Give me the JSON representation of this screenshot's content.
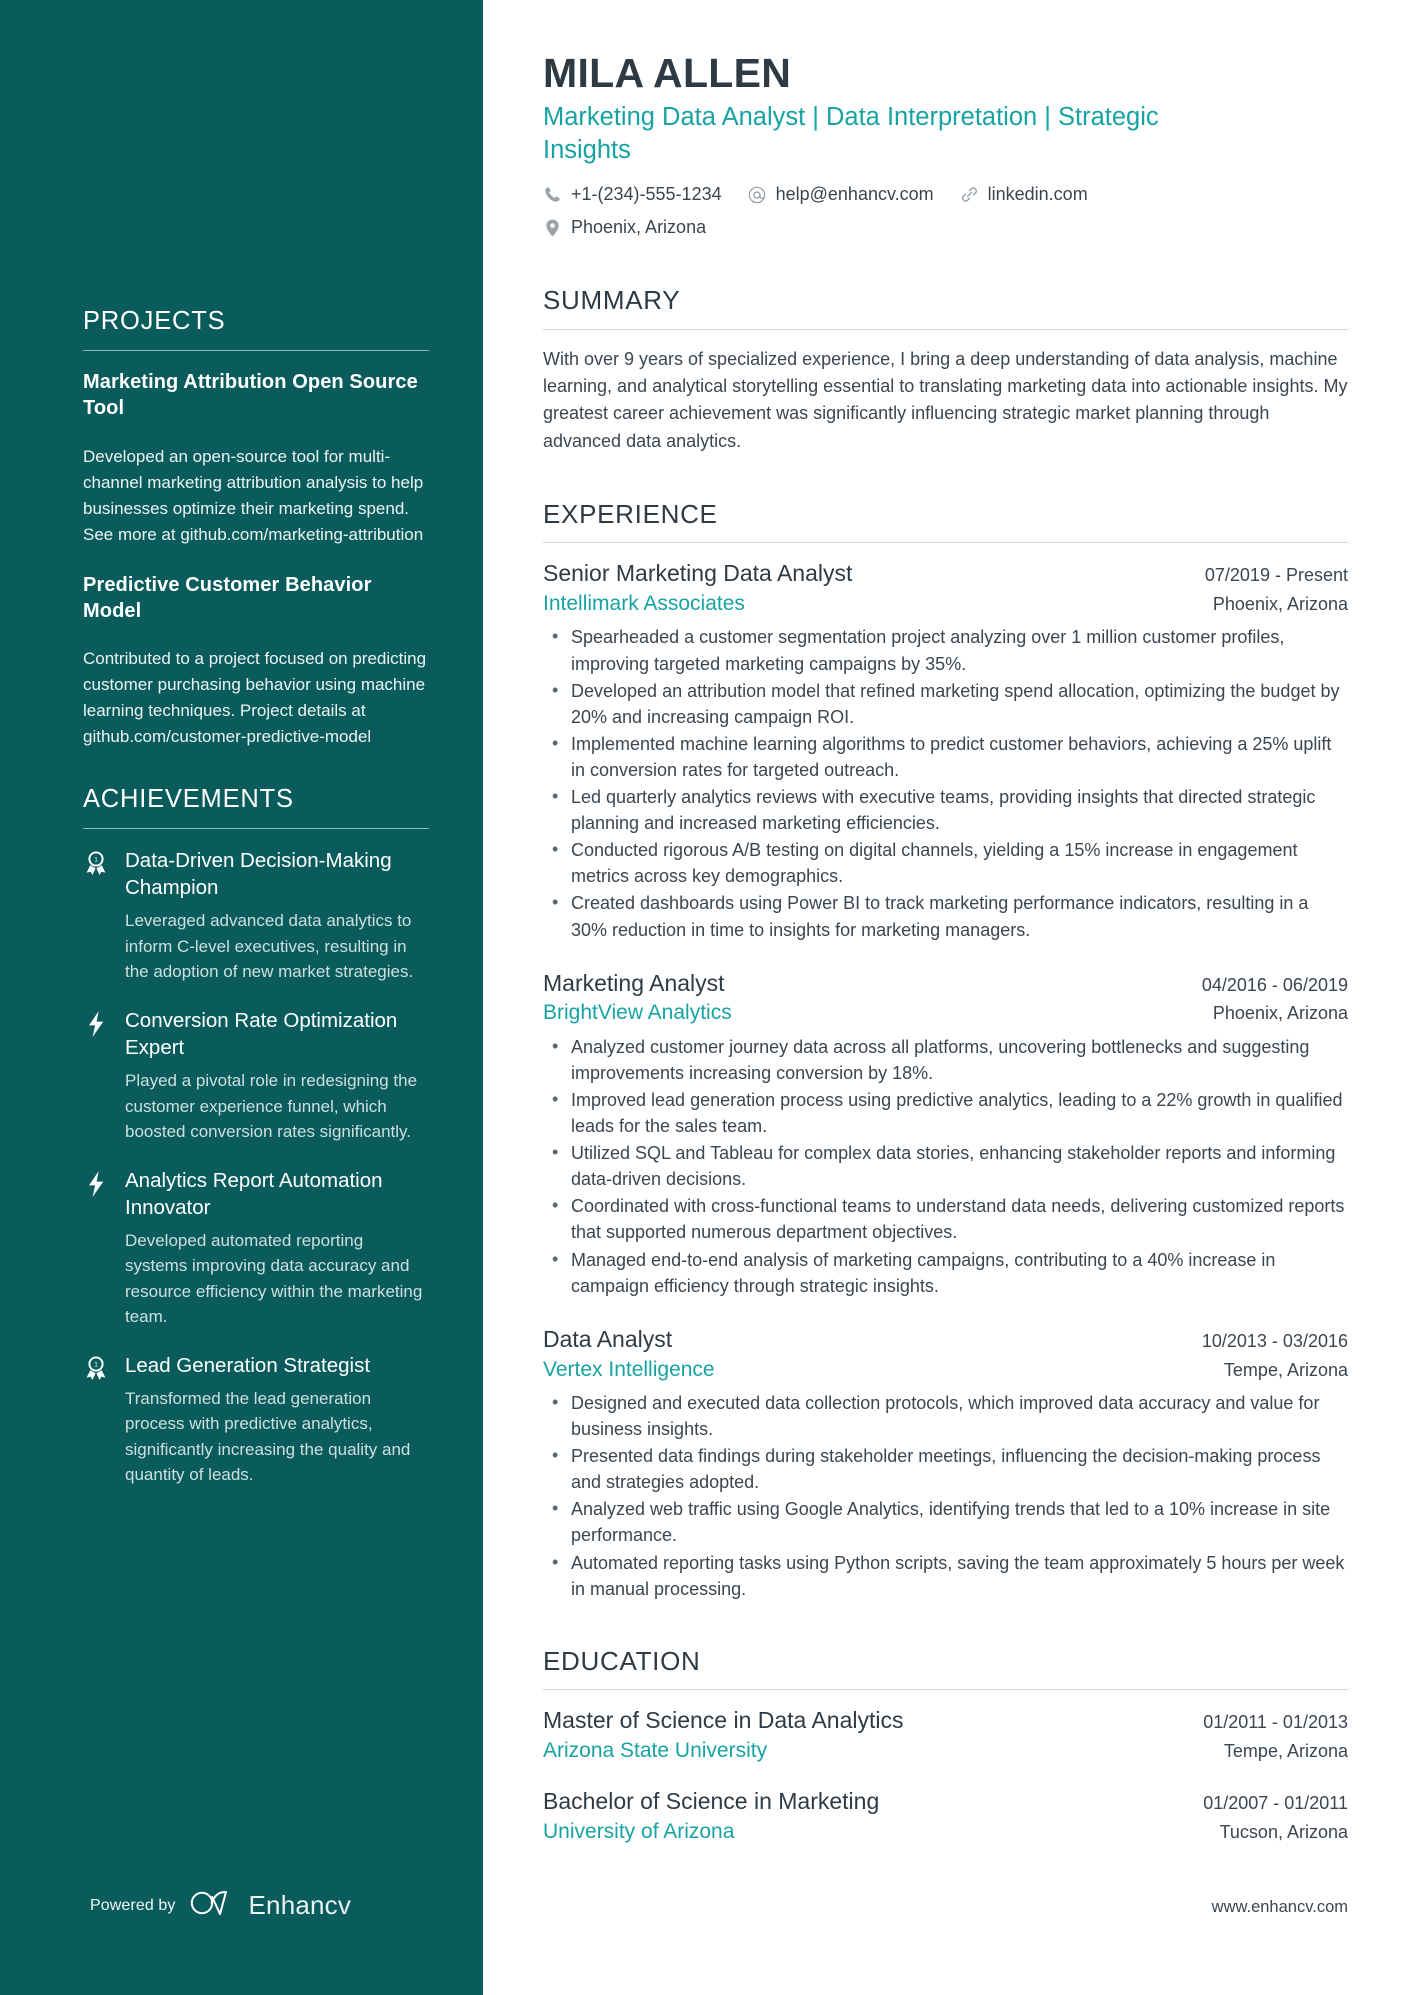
{
  "header": {
    "name": "MILA ALLEN",
    "headline": "Marketing Data Analyst | Data Interpretation | Strategic Insights",
    "contacts": [
      {
        "icon": "phone-icon",
        "text": "+1-(234)-555-1234"
      },
      {
        "icon": "email-icon",
        "text": "help@enhancv.com"
      },
      {
        "icon": "link-icon",
        "text": "linkedin.com"
      },
      {
        "icon": "location-icon",
        "text": "Phoenix, Arizona"
      }
    ]
  },
  "sidebar": {
    "projects": {
      "title": "PROJECTS",
      "items": [
        {
          "title": "Marketing Attribution Open Source Tool",
          "description": "Developed an open-source tool for multi-channel marketing attribution analysis to help businesses optimize their marketing spend. See more at github.com/marketing-attribution"
        },
        {
          "title": "Predictive Customer Behavior Model",
          "description": "Contributed to a project focused on predicting customer purchasing behavior using machine learning techniques. Project details at github.com/customer-predictive-model"
        }
      ]
    },
    "achievements": {
      "title": "ACHIEVEMENTS",
      "items": [
        {
          "icon": "medal-icon",
          "title": "Data-Driven Decision-Making Champion",
          "description": "Leveraged advanced data analytics to inform C-level executives, resulting in the adoption of new market strategies."
        },
        {
          "icon": "bolt-icon",
          "title": "Conversion Rate Optimization Expert",
          "description": "Played a pivotal role in redesigning the customer experience funnel, which boosted conversion rates significantly."
        },
        {
          "icon": "bolt-icon",
          "title": "Analytics Report Automation Innovator",
          "description": "Developed automated reporting systems improving data accuracy and resource efficiency within the marketing team."
        },
        {
          "icon": "medal-icon",
          "title": "Lead Generation Strategist",
          "description": "Transformed the lead generation process with predictive analytics, significantly increasing the quality and quantity of leads."
        }
      ]
    },
    "footer": {
      "powered_by": "Powered by",
      "brand": "Enhancv",
      "logo_icon": "enhancv-logo-icon"
    }
  },
  "main": {
    "summary": {
      "title": "SUMMARY",
      "text": "With over 9 years of specialized experience, I bring a deep understanding of data analysis, machine learning, and analytical storytelling essential to translating marketing data into actionable insights. My greatest career achievement was significantly influencing strategic market planning through advanced data analytics."
    },
    "experience": {
      "title": "EXPERIENCE",
      "entries": [
        {
          "role": "Senior Marketing Data Analyst",
          "dates": "07/2019 - Present",
          "company": "Intellimark Associates",
          "location": "Phoenix, Arizona",
          "bullets": [
            "Spearheaded a customer segmentation project analyzing over 1 million customer profiles, improving targeted marketing campaigns by 35%.",
            "Developed an attribution model that refined marketing spend allocation, optimizing the budget by 20% and increasing campaign ROI.",
            "Implemented machine learning algorithms to predict customer behaviors, achieving a 25% uplift in conversion rates for targeted outreach.",
            "Led quarterly analytics reviews with executive teams, providing insights that directed strategic planning and increased marketing efficiencies.",
            "Conducted rigorous A/B testing on digital channels, yielding a 15% increase in engagement metrics across key demographics.",
            "Created dashboards using Power BI to track marketing performance indicators, resulting in a 30% reduction in time to insights for marketing managers."
          ]
        },
        {
          "role": "Marketing Analyst",
          "dates": "04/2016 - 06/2019",
          "company": "BrightView Analytics",
          "location": "Phoenix, Arizona",
          "bullets": [
            "Analyzed customer journey data across all platforms, uncovering bottlenecks and suggesting improvements increasing conversion by 18%.",
            "Improved lead generation process using predictive analytics, leading to a 22% growth in qualified leads for the sales team.",
            "Utilized SQL and Tableau for complex data stories, enhancing stakeholder reports and informing data-driven decisions.",
            "Coordinated with cross-functional teams to understand data needs, delivering customized reports that supported numerous department objectives.",
            "Managed end-to-end analysis of marketing campaigns, contributing to a 40% increase in campaign efficiency through strategic insights."
          ]
        },
        {
          "role": "Data Analyst",
          "dates": "10/2013 - 03/2016",
          "company": "Vertex Intelligence",
          "location": "Tempe, Arizona",
          "bullets": [
            "Designed and executed data collection protocols, which improved data accuracy and value for business insights.",
            "Presented data findings during stakeholder meetings, influencing the decision-making process and strategies adopted.",
            "Analyzed web traffic using Google Analytics, identifying trends that led to a 10% increase in site performance.",
            "Automated reporting tasks using Python scripts, saving the team approximately 5 hours per week in manual processing."
          ]
        }
      ]
    },
    "education": {
      "title": "EDUCATION",
      "entries": [
        {
          "degree": "Master of Science in Data Analytics",
          "dates": "01/2011 - 01/2013",
          "school": "Arizona State University",
          "location": "Tempe, Arizona"
        },
        {
          "degree": "Bachelor of Science in Marketing",
          "dates": "01/2007 - 01/2011",
          "school": "University of Arizona",
          "location": "Tucson, Arizona"
        }
      ]
    },
    "footer": {
      "website": "www.enhancv.com"
    }
  },
  "colors": {
    "sidebar_bg": "#0a5c5c",
    "accent_teal": "#18a3a3",
    "text_dark": "#2e3a44",
    "text_body": "#3b4650"
  }
}
